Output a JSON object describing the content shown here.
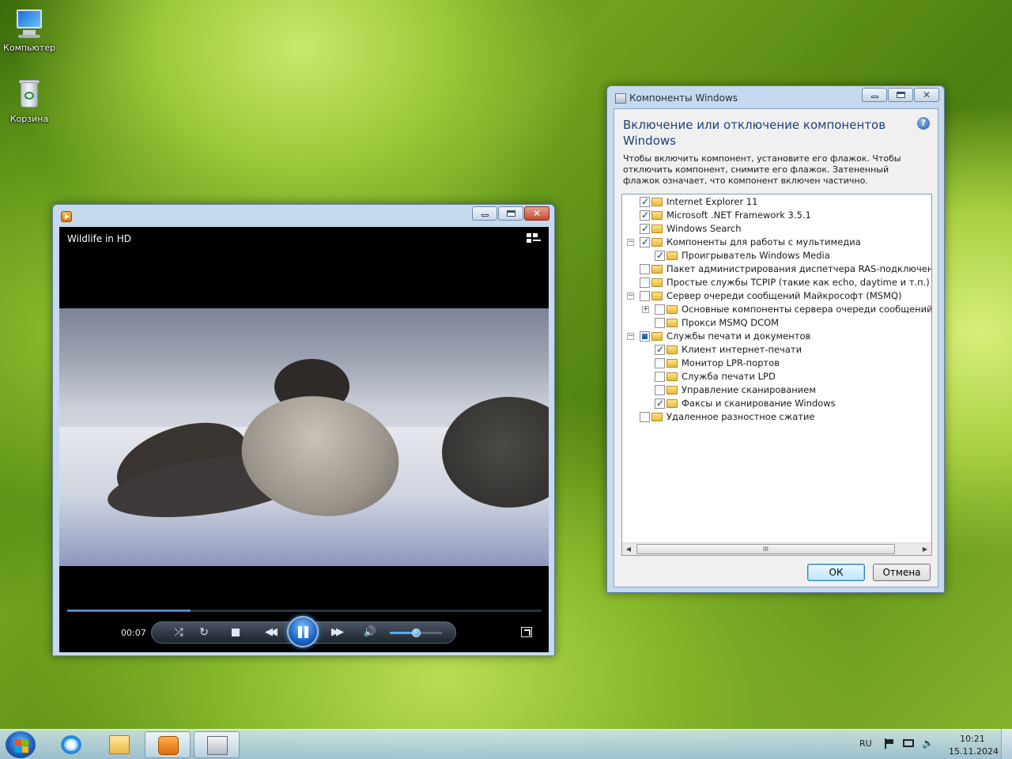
{
  "desktop": {
    "icons": [
      {
        "label": "Компьютер"
      },
      {
        "label": "Корзина"
      }
    ]
  },
  "media_player": {
    "video_title": "Wildlife in HD",
    "elapsed_time": "00:07",
    "progress_fraction": 0.26,
    "volume_fraction": 0.5,
    "state": "playing",
    "icons": {
      "shuffle": "shuffle-icon",
      "repeat": "repeat-icon",
      "stop": "stop-icon",
      "previous": "rewind-icon",
      "pause": "pause-icon",
      "next": "fast-forward-icon",
      "mute": "speaker-icon",
      "switch_view": "switch-to-library-icon",
      "fullscreen": "fullscreen-icon"
    },
    "accent_color": "#2f7fd8"
  },
  "features_dialog": {
    "window_title": "Компоненты Windows",
    "heading": "Включение или отключение компонентов Windows",
    "description": "Чтобы включить компонент, установите его флажок. Чтобы отключить компонент, снимите его флажок. Затененный флажок означает, что компонент включен частично.",
    "help_icon": "?",
    "scroll_thumb_grip": "III",
    "items": [
      {
        "label": "Internet Explorer 11",
        "state": "checked",
        "level": 0,
        "expander": ""
      },
      {
        "label": "Microsoft .NET Framework 3.5.1",
        "state": "checked",
        "level": 0,
        "expander": ""
      },
      {
        "label": "Windows Search",
        "state": "checked",
        "level": 0,
        "expander": ""
      },
      {
        "label": "Компоненты для работы с мультимедиа",
        "state": "checked",
        "level": 0,
        "expander": "−"
      },
      {
        "label": "Проигрыватель Windows Media",
        "state": "checked",
        "level": 1,
        "expander": ""
      },
      {
        "label": "Пакет администрирования диспетчера RAS-подключений (C",
        "state": "unchecked",
        "level": 0,
        "expander": ""
      },
      {
        "label": "Простые службы TCPIP (такие как echo, daytime и т.п.)",
        "state": "unchecked",
        "level": 0,
        "expander": ""
      },
      {
        "label": "Сервер очереди сообщений Майкрософт (MSMQ)",
        "state": "unchecked",
        "level": 0,
        "expander": "−"
      },
      {
        "label": "Основные компоненты сервера очереди сообщений (MS",
        "state": "unchecked",
        "level": 1,
        "expander": "+"
      },
      {
        "label": "Прокси MSMQ DCOM",
        "state": "unchecked",
        "level": 1,
        "expander": ""
      },
      {
        "label": "Службы печати и документов",
        "state": "partial",
        "level": 0,
        "expander": "−"
      },
      {
        "label": "Клиент интернет-печати",
        "state": "checked",
        "level": 1,
        "expander": ""
      },
      {
        "label": "Монитор LPR-портов",
        "state": "unchecked",
        "level": 1,
        "expander": ""
      },
      {
        "label": "Служба печати LPD",
        "state": "unchecked",
        "level": 1,
        "expander": ""
      },
      {
        "label": "Управление сканированием",
        "state": "unchecked",
        "level": 1,
        "expander": ""
      },
      {
        "label": "Факсы и сканирование Windows",
        "state": "checked",
        "level": 1,
        "expander": ""
      },
      {
        "label": "Удаленное разностное сжатие",
        "state": "unchecked",
        "level": 0,
        "expander": ""
      }
    ],
    "ok_label": "ОК",
    "cancel_label": "Отмена"
  },
  "taskbar": {
    "pinned": [
      "start-orb",
      "internet-explorer-icon",
      "windows-explorer-icon",
      "windows-media-player-icon",
      "windows-features-icon"
    ],
    "active_item": "windows-media-player",
    "language": "RU",
    "time": "10:21",
    "date": "15.11.2024"
  }
}
